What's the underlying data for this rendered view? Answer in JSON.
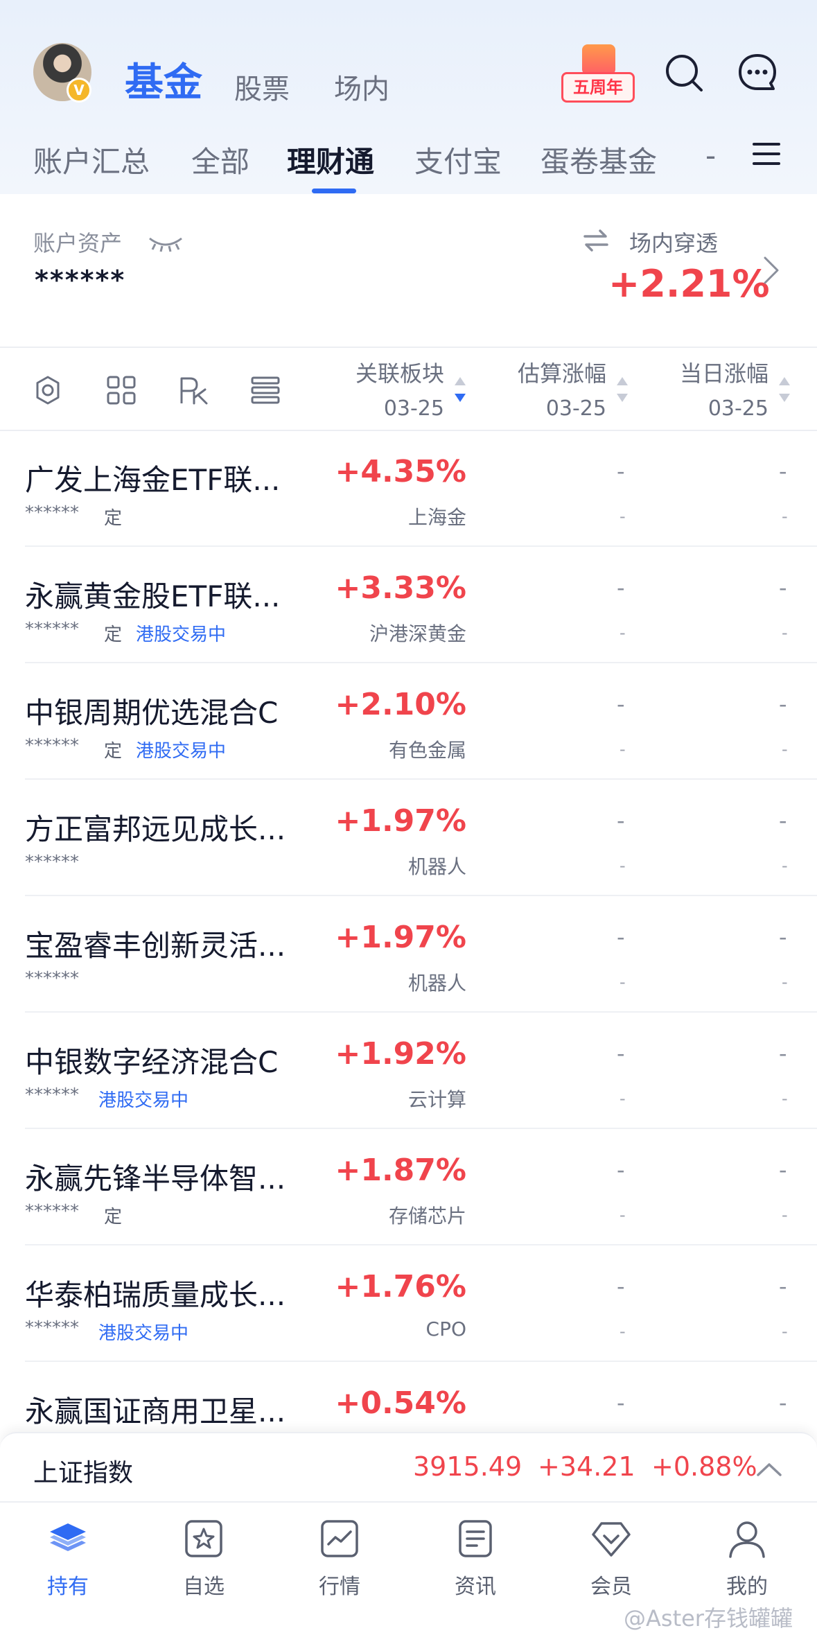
{
  "header": {
    "tabs": [
      {
        "label": "基金",
        "active": true
      },
      {
        "label": "股票",
        "active": false
      },
      {
        "label": "场内",
        "active": false
      }
    ],
    "avatar_badge": "V",
    "anniversary_label": "五周年",
    "icons": [
      "search-icon",
      "chat-icon"
    ]
  },
  "subtabs": [
    {
      "label": "账户汇总",
      "active": false
    },
    {
      "label": "全部",
      "active": false
    },
    {
      "label": "理财通",
      "active": true
    },
    {
      "label": "支付宝",
      "active": false
    },
    {
      "label": "蛋卷基金",
      "active": false
    },
    {
      "label": "-",
      "active": false
    }
  ],
  "assets": {
    "label": "账户资产",
    "value": "******",
    "penetration_label": "场内穿透",
    "penetration_value": "+2.21%"
  },
  "table": {
    "columns": [
      {
        "label": "关联板块",
        "date": "03-25"
      },
      {
        "label": "估算涨幅",
        "date": "03-25"
      },
      {
        "label": "当日涨幅",
        "date": "03-25"
      }
    ],
    "rows": [
      {
        "name": "广发上海金ETF联...",
        "masked": "******",
        "tag": "定",
        "hk": "",
        "pct": "+4.35%",
        "sector": "上海金",
        "est": "-",
        "est_sub": "-",
        "day": "-",
        "day_sub": "-"
      },
      {
        "name": "永赢黄金股ETF联...",
        "masked": "******",
        "tag": "定",
        "hk": "港股交易中",
        "pct": "+3.33%",
        "sector": "沪港深黄金",
        "est": "-",
        "est_sub": "-",
        "day": "-",
        "day_sub": "-"
      },
      {
        "name": "中银周期优选混合C",
        "masked": "******",
        "tag": "定",
        "hk": "港股交易中",
        "pct": "+2.10%",
        "sector": "有色金属",
        "est": "-",
        "est_sub": "-",
        "day": "-",
        "day_sub": "-"
      },
      {
        "name": "方正富邦远见成长...",
        "masked": "******",
        "tag": "",
        "hk": "",
        "pct": "+1.97%",
        "sector": "机器人",
        "est": "-",
        "est_sub": "-",
        "day": "-",
        "day_sub": "-"
      },
      {
        "name": "宝盈睿丰创新灵活...",
        "masked": "******",
        "tag": "",
        "hk": "",
        "pct": "+1.97%",
        "sector": "机器人",
        "est": "-",
        "est_sub": "-",
        "day": "-",
        "day_sub": "-"
      },
      {
        "name": "中银数字经济混合C",
        "masked": "******",
        "tag": "",
        "hk": "港股交易中",
        "pct": "+1.92%",
        "sector": "云计算",
        "est": "-",
        "est_sub": "-",
        "day": "-",
        "day_sub": "-"
      },
      {
        "name": "永赢先锋半导体智...",
        "masked": "******",
        "tag": "定",
        "hk": "",
        "pct": "+1.87%",
        "sector": "存储芯片",
        "est": "-",
        "est_sub": "-",
        "day": "-",
        "day_sub": "-"
      },
      {
        "name": "华泰柏瑞质量成长...",
        "masked": "******",
        "tag": "",
        "hk": "港股交易中",
        "pct": "+1.76%",
        "sector": "CPO",
        "est": "-",
        "est_sub": "-",
        "day": "-",
        "day_sub": "-"
      },
      {
        "name": "永赢国证商用卫星...",
        "masked": "",
        "tag": "",
        "hk": "",
        "pct": "+0.54%",
        "sector": "",
        "est": "-",
        "est_sub": "",
        "day": "-",
        "day_sub": ""
      }
    ]
  },
  "index_bar": {
    "name": "上证指数",
    "value": "3915.49",
    "change": "+34.21",
    "change_pct": "+0.88%"
  },
  "bottom_nav": [
    {
      "label": "持有",
      "icon": "layers-icon",
      "active": true
    },
    {
      "label": "自选",
      "icon": "star-icon",
      "active": false
    },
    {
      "label": "行情",
      "icon": "chart-icon",
      "active": false
    },
    {
      "label": "资讯",
      "icon": "document-icon",
      "active": false
    },
    {
      "label": "会员",
      "icon": "diamond-icon",
      "active": false
    },
    {
      "label": "我的",
      "icon": "profile-icon",
      "active": false
    }
  ],
  "watermark": "@Aster存钱罐罐",
  "colors": {
    "accent": "#2f6bf3",
    "up": "#f0444c",
    "text": "#151a2e",
    "muted": "#6a7080"
  }
}
